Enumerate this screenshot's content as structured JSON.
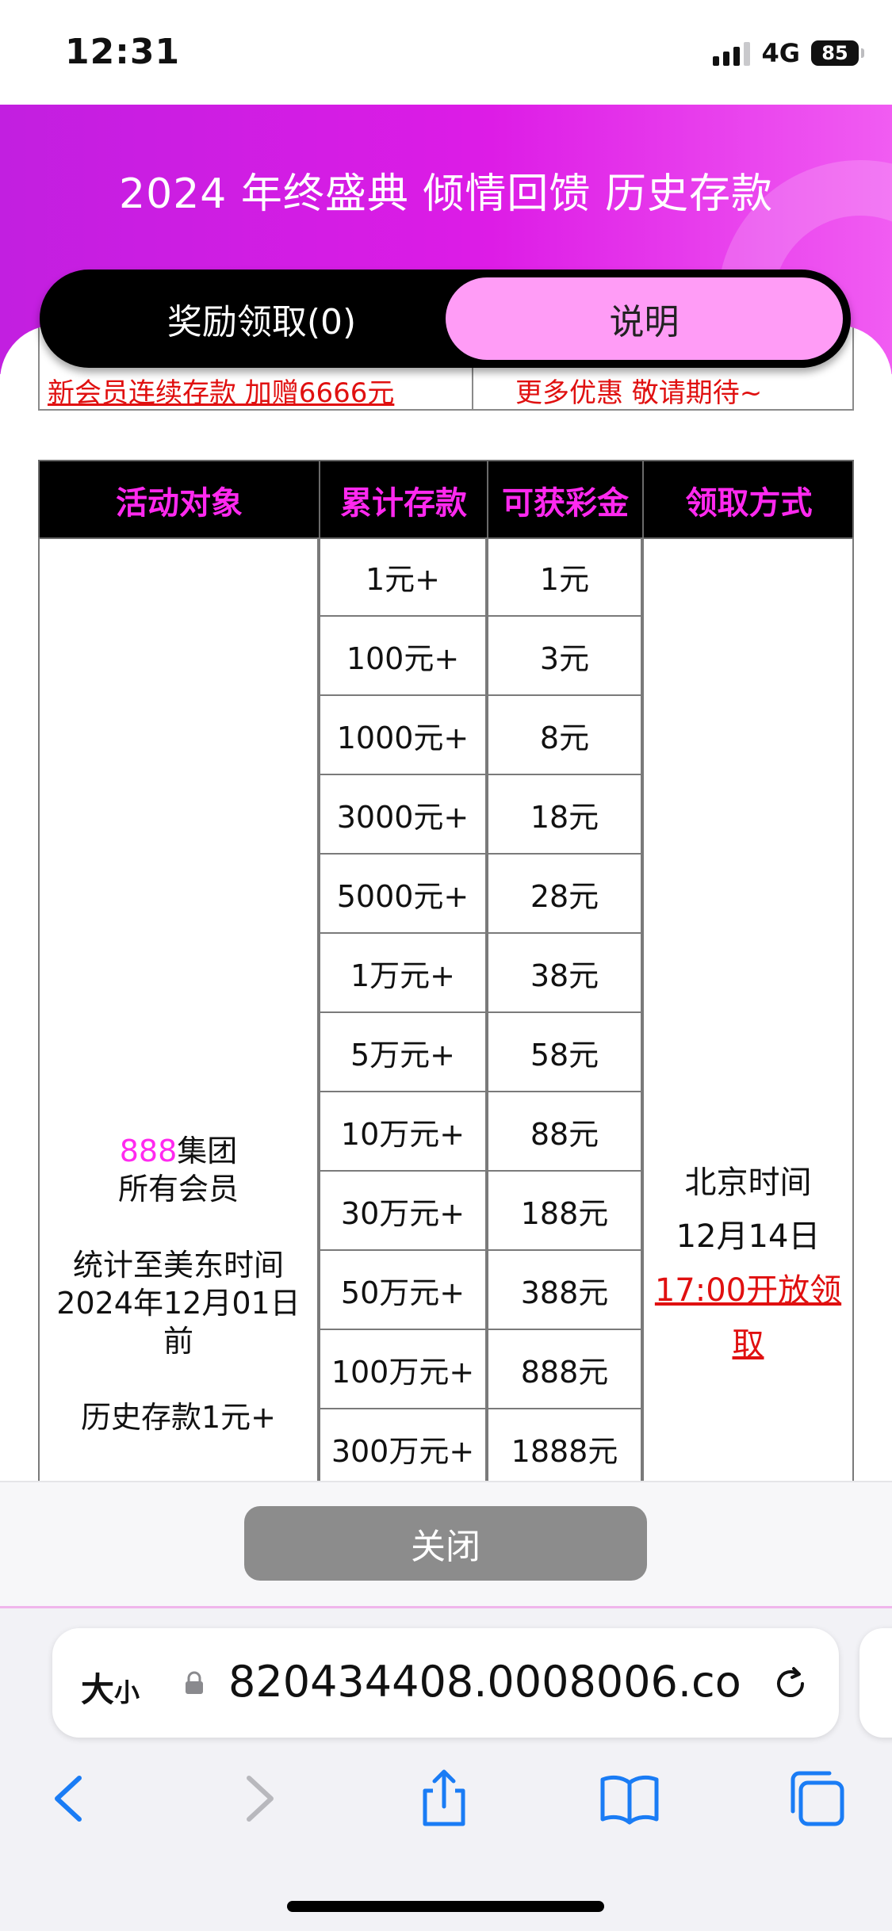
{
  "status_bar": {
    "time": "12:31",
    "network": "4G",
    "battery": "85"
  },
  "header": {
    "title": "2024 年终盛典 倾情回馈 历史存款"
  },
  "tabs": [
    {
      "label": "奖励领取(0)",
      "active": false
    },
    {
      "label": "说明",
      "active": true
    }
  ],
  "previous_row": {
    "left": "新会员连续存款 加赠6666元",
    "right": "更多优惠 敬请期待~"
  },
  "table": {
    "headers": [
      "活动对象",
      "累计存款",
      "可获彩金",
      "领取方式"
    ],
    "rows": [
      {
        "deposit": "1元+",
        "bonus": "1元"
      },
      {
        "deposit": "100元+",
        "bonus": "3元"
      },
      {
        "deposit": "1000元+",
        "bonus": "8元"
      },
      {
        "deposit": "3000元+",
        "bonus": "18元"
      },
      {
        "deposit": "5000元+",
        "bonus": "28元"
      },
      {
        "deposit": "1万元+",
        "bonus": "38元"
      },
      {
        "deposit": "5万元+",
        "bonus": "58元"
      },
      {
        "deposit": "10万元+",
        "bonus": "88元"
      },
      {
        "deposit": "30万元+",
        "bonus": "188元"
      },
      {
        "deposit": "50万元+",
        "bonus": "388元"
      },
      {
        "deposit": "100万元+",
        "bonus": "888元"
      },
      {
        "deposit": "300万元+",
        "bonus": "1888元"
      }
    ],
    "audience": {
      "group_highlight": "888",
      "group_rest": "集团",
      "line2": "所有会员",
      "line3": "统计至美东时间",
      "line4": "2024年12月01日",
      "line5": "前",
      "line6": "历史存款1元+"
    },
    "method": {
      "line1": "北京时间",
      "line2": "12月14日",
      "link": "17:00开放领取"
    }
  },
  "close_button": {
    "label": "关闭"
  },
  "browser": {
    "text_size_big": "大",
    "text_size_small": "小",
    "url": "820434408.0008006.co",
    "icons": [
      "lock-icon",
      "reload-icon",
      "back-icon",
      "forward-icon",
      "share-icon",
      "bookmarks-icon",
      "tabs-icon"
    ]
  },
  "colors": {
    "brand": "#dd1ce6",
    "header_text": "#ff29ef",
    "link": "#e01010",
    "active_tab": "#ff9cf6"
  }
}
